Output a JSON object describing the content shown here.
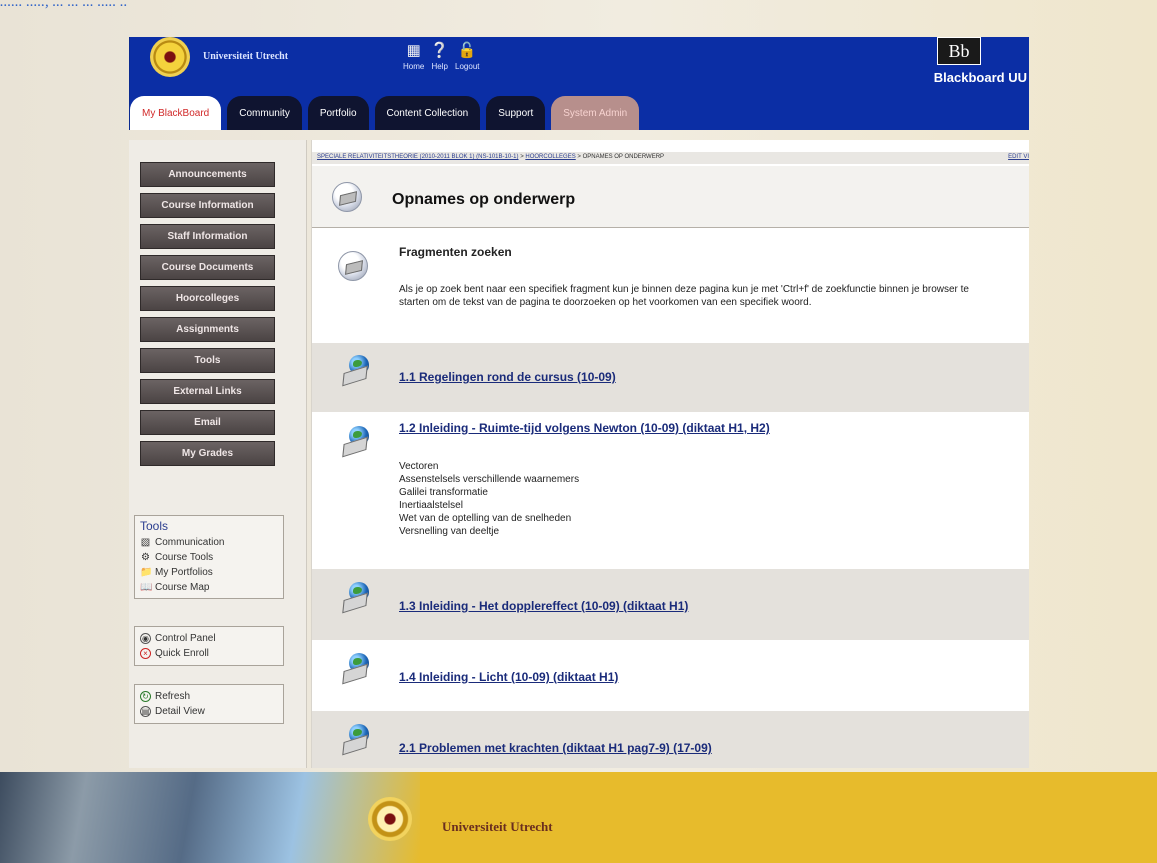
{
  "top_caption": "...... ....., ... ... ... ..... ..",
  "header": {
    "university": "Universiteit Utrecht",
    "nav": [
      {
        "label": "Home",
        "icon": "home-icon"
      },
      {
        "label": "Help",
        "icon": "help-icon"
      },
      {
        "label": "Logout",
        "icon": "lock-icon"
      }
    ],
    "bb_logo": "Bb",
    "bb_text": "Blackboard UU",
    "colors": {
      "header_bg": "#0b2ea5",
      "active_tab_text": "#d12a2a",
      "tab_bg": "#0f1430"
    }
  },
  "tabs": [
    "My BlackBoard",
    "Community",
    "Portfolio",
    "Content Collection",
    "Support",
    "System Admin"
  ],
  "sidebar": {
    "buttons": [
      "Announcements",
      "Course Information",
      "Staff Information",
      "Course Documents",
      "Hoorcolleges",
      "Assignments",
      "Tools",
      "External Links",
      "Email",
      "My Grades"
    ],
    "tools_title": "Tools",
    "tools": [
      "Communication",
      "Course Tools",
      "My Portfolios",
      "Course Map"
    ],
    "control": [
      "Control Panel",
      "Quick Enroll"
    ],
    "view": [
      "Refresh",
      "Detail View"
    ]
  },
  "breadcrumb": {
    "parts": [
      "SPECIALE RELATIVITEITSTHEORIE (2010-2011 BLOK 1) (NS-101B-10-1)",
      "HOORCOLLEGES"
    ],
    "current": "OPNAMES OP ONDERWERP",
    "edit_view": "EDIT VI"
  },
  "page_title": "Opnames op onderwerp",
  "intro": {
    "title": "Fragmenten zoeken",
    "text": "Als je op zoek bent naar een specifiek fragment kun je binnen deze pagina kun je met 'Ctrl+f' de zoekfunctie binnen je browser te starten om de tekst van de pagina te doorzoeken op het voorkomen van een specifiek woord."
  },
  "items": [
    {
      "title": "1.1 Regelingen rond de cursus (10-09)"
    },
    {
      "title": "1.2 Inleiding - Ruimte-tijd volgens Newton (10-09) (diktaat H1, H2)",
      "subs": [
        "Vectoren",
        "Assenstelsels verschillende waarnemers",
        "Galilei transformatie",
        "Inertiaalstelsel",
        "Wet van de optelling van de snelheden",
        "Versnelling van deeltje"
      ]
    },
    {
      "title": "1.3 Inleiding - Het dopplereffect (10-09) (diktaat H1)"
    },
    {
      "title": "1.4 Inleiding - Licht (10-09) (diktaat H1)"
    },
    {
      "title": "2.1 Problemen met krachten (diktaat H1 pag7-9) (17-09)"
    }
  ],
  "footer": {
    "university": "Universiteit Utrecht"
  }
}
